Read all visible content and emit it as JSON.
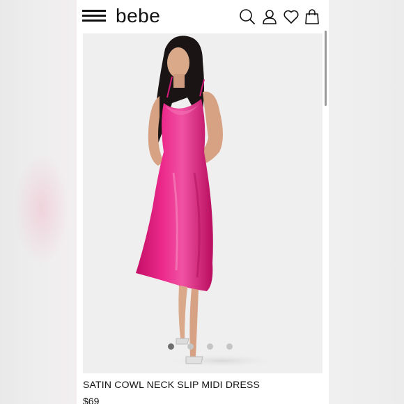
{
  "brand": {
    "logo_text": "bebe"
  },
  "header": {
    "icons": [
      "menu-icon",
      "search-icon",
      "account-icon",
      "heart-icon",
      "bag-icon"
    ]
  },
  "product": {
    "name": "SATIN COWL NECK SLIP MIDI DRESS",
    "price": "$69",
    "image_count": 4,
    "active_image": 1,
    "dress_color": "#e5197f"
  },
  "colors": {
    "background": "#f1f1f1",
    "page": "#ffffff",
    "text": "#111111",
    "dot_active": "#6e6e6e",
    "dot_inactive": "#c5c5c5"
  }
}
